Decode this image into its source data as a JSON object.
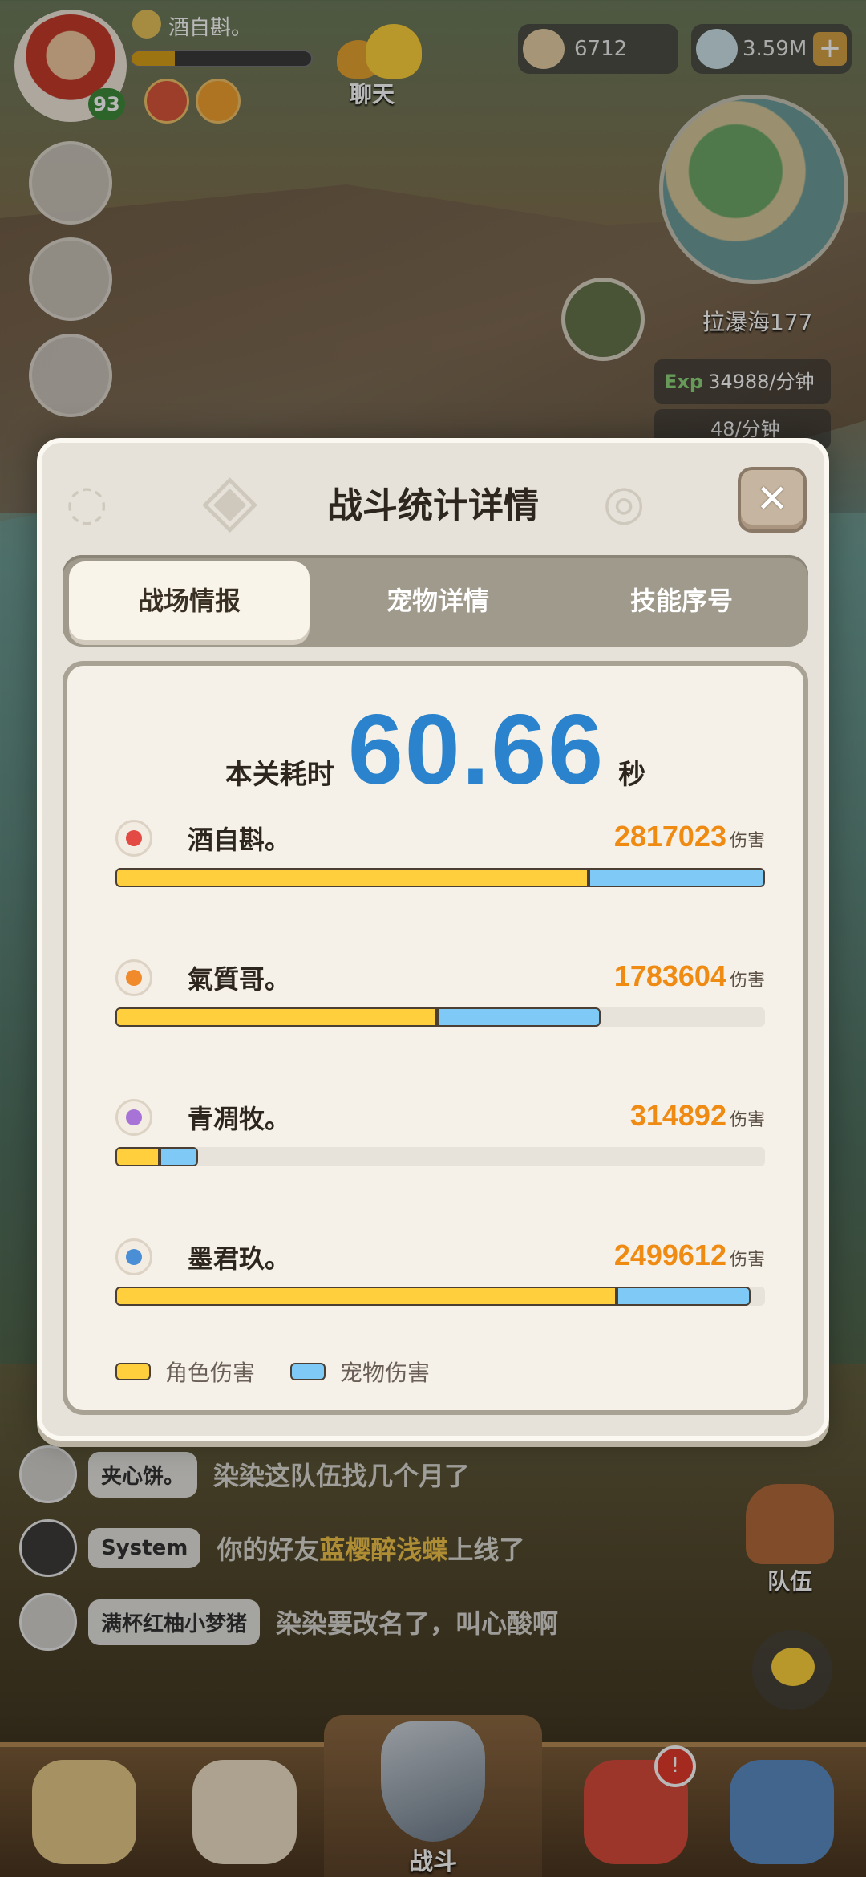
{
  "hud": {
    "player_name": "酒自斟。",
    "player_level": "93",
    "chat_label": "聊天",
    "resource1": "6712",
    "resource2": "3.59M",
    "zone_name": "拉瀑海177",
    "exp_label": "Exp",
    "exp_rate": "34988/分钟",
    "pet_rate": "48/分钟"
  },
  "modal": {
    "title": "战斗统计详情",
    "close": "✕",
    "tabs": [
      "战场情报",
      "宠物详情",
      "技能序号"
    ],
    "time_label": "本关耗时",
    "time_value": "60.66",
    "time_unit": "秒",
    "damage_unit": "伤害",
    "players": [
      {
        "name": "酒自斟。",
        "damage": "2817023",
        "role_frac": 0.729,
        "pet_frac": 0.271,
        "icon": "red-class-icon"
      },
      {
        "name": "氣質哥。",
        "damage": "1783604",
        "role_frac": 0.495,
        "pet_frac": 0.252,
        "icon": "orange-class-icon"
      },
      {
        "name": "青凋牧。",
        "damage": "314892",
        "role_frac": 0.068,
        "pet_frac": 0.059,
        "icon": "purple-class-icon"
      },
      {
        "name": "墨君玖。",
        "damage": "2499612",
        "role_frac": 0.771,
        "pet_frac": 0.207,
        "icon": "blue-class-icon"
      }
    ],
    "legend": {
      "role": "角色伤害",
      "pet": "宠物伤害"
    }
  },
  "chat": [
    {
      "sender": "夹心饼。",
      "message": "染染这队伍找几个月了"
    },
    {
      "sender": "System",
      "message_pre": "你的好友",
      "highlight": "蓝樱醉浅蝶",
      "message_post": "上线了"
    },
    {
      "sender": "满杯红柚小梦猪",
      "message": "染染要改名了，叫心酸啊"
    }
  ],
  "side": {
    "team_label": "队伍"
  },
  "bottom_nav": {
    "battle_label": "战斗"
  },
  "colors": {
    "role_damage": "#ffcf3e",
    "pet_damage": "#7ec9f5",
    "time_blue": "#2a83cc",
    "damage_orange": "#ef8a12"
  }
}
